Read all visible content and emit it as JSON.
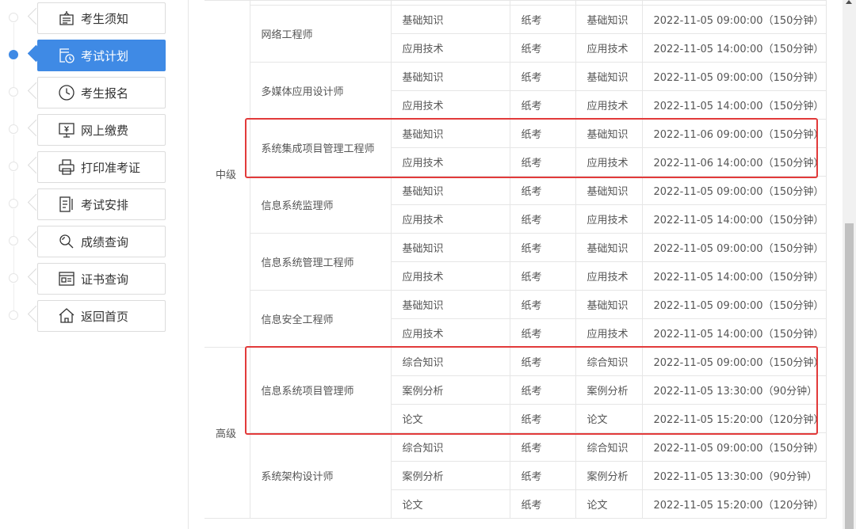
{
  "sidebar": {
    "items": [
      {
        "label": "考生须知",
        "icon": "notice-icon",
        "active": false
      },
      {
        "label": "考试计划",
        "icon": "calendar-clock-icon",
        "active": true
      },
      {
        "label": "考生报名",
        "icon": "clock-icon",
        "active": false
      },
      {
        "label": "网上缴费",
        "icon": "payment-monitor-icon",
        "active": false
      },
      {
        "label": "打印准考证",
        "icon": "printer-icon",
        "active": false
      },
      {
        "label": "考试安排",
        "icon": "document-icon",
        "active": false
      },
      {
        "label": "成绩查询",
        "icon": "search-icon",
        "active": false
      },
      {
        "label": "证书查询",
        "icon": "certificate-icon",
        "active": false
      },
      {
        "label": "返回首页",
        "icon": "home-icon",
        "active": false
      }
    ]
  },
  "schedule": {
    "groups": [
      {
        "level": "中级",
        "exams": [
          {
            "name": "网络工程师",
            "rows": [
              {
                "subject": "基础知识",
                "form": "纸考",
                "subject2": "基础知识",
                "time": "2022-11-05 09:00:00（150分钟）"
              },
              {
                "subject": "应用技术",
                "form": "纸考",
                "subject2": "应用技术",
                "time": "2022-11-05 14:00:00（150分钟）"
              }
            ]
          },
          {
            "name": "多媒体应用设计师",
            "rows": [
              {
                "subject": "基础知识",
                "form": "纸考",
                "subject2": "基础知识",
                "time": "2022-11-05 09:00:00（150分钟）"
              },
              {
                "subject": "应用技术",
                "form": "纸考",
                "subject2": "应用技术",
                "time": "2022-11-05 14:00:00（150分钟）"
              }
            ]
          },
          {
            "name": "系统集成项目管理工程师",
            "rows": [
              {
                "subject": "基础知识",
                "form": "纸考",
                "subject2": "基础知识",
                "time": "2022-11-06 09:00:00（150分钟）"
              },
              {
                "subject": "应用技术",
                "form": "纸考",
                "subject2": "应用技术",
                "time": "2022-11-06 14:00:00（150分钟）"
              }
            ]
          },
          {
            "name": "信息系统监理师",
            "rows": [
              {
                "subject": "基础知识",
                "form": "纸考",
                "subject2": "基础知识",
                "time": "2022-11-05 09:00:00（150分钟）"
              },
              {
                "subject": "应用技术",
                "form": "纸考",
                "subject2": "应用技术",
                "time": "2022-11-05 14:00:00（150分钟）"
              }
            ]
          },
          {
            "name": "信息系统管理工程师",
            "rows": [
              {
                "subject": "基础知识",
                "form": "纸考",
                "subject2": "基础知识",
                "time": "2022-11-05 09:00:00（150分钟）"
              },
              {
                "subject": "应用技术",
                "form": "纸考",
                "subject2": "应用技术",
                "time": "2022-11-05 14:00:00（150分钟）"
              }
            ]
          },
          {
            "name": "信息安全工程师",
            "rows": [
              {
                "subject": "基础知识",
                "form": "纸考",
                "subject2": "基础知识",
                "time": "2022-11-05 09:00:00（150分钟）"
              },
              {
                "subject": "应用技术",
                "form": "纸考",
                "subject2": "应用技术",
                "time": "2022-11-05 14:00:00（150分钟）"
              }
            ]
          }
        ]
      },
      {
        "level": "高级",
        "exams": [
          {
            "name": "信息系统项目管理师",
            "rows": [
              {
                "subject": "综合知识",
                "form": "纸考",
                "subject2": "综合知识",
                "time": "2022-11-05 09:00:00（150分钟）"
              },
              {
                "subject": "案例分析",
                "form": "纸考",
                "subject2": "案例分析",
                "time": "2022-11-05 13:30:00（90分钟）"
              },
              {
                "subject": "论文",
                "form": "纸考",
                "subject2": "论文",
                "time": "2022-11-05 15:20:00（120分钟）"
              }
            ]
          },
          {
            "name": "系统架构设计师",
            "rows": [
              {
                "subject": "综合知识",
                "form": "纸考",
                "subject2": "综合知识",
                "time": "2022-11-05 09:00:00（150分钟）"
              },
              {
                "subject": "案例分析",
                "form": "纸考",
                "subject2": "案例分析",
                "time": "2022-11-05 13:30:00（90分钟）"
              },
              {
                "subject": "论文",
                "form": "纸考",
                "subject2": "论文",
                "time": "2022-11-05 15:20:00（120分钟）"
              }
            ]
          }
        ]
      }
    ],
    "highlighted_exams": [
      "系统集成项目管理工程师",
      "信息系统项目管理师"
    ],
    "highlight_color": "#e23a3a"
  },
  "colors": {
    "accent": "#3f8ae5",
    "border": "#e6e6e6"
  }
}
